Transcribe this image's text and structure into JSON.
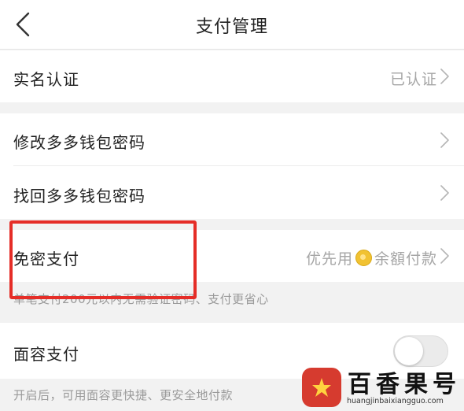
{
  "header": {
    "title": "支付管理",
    "back_icon": "chevron-left-icon"
  },
  "rows": {
    "real_name": {
      "label": "实名认证",
      "value": "已认证"
    },
    "change_password": {
      "label": "修改多多钱包密码"
    },
    "recover_password": {
      "label": "找回多多钱包密码"
    },
    "password_free": {
      "label": "免密支付",
      "value_prefix": "优先用",
      "value_suffix": "余額付款",
      "description": "单笔支付200元以内无需验证密码、支付更省心"
    },
    "face_pay": {
      "label": "面容支付",
      "toggle_on": false,
      "description": "开启后，可用面容更快捷、更安全地付款"
    }
  },
  "watermark": {
    "title": "百香果号",
    "url": "huangjinbaixiangguo.com"
  },
  "colors": {
    "highlight": "#e52d27",
    "brand_logo": "#d63b2f",
    "coin": "#f1c232"
  }
}
